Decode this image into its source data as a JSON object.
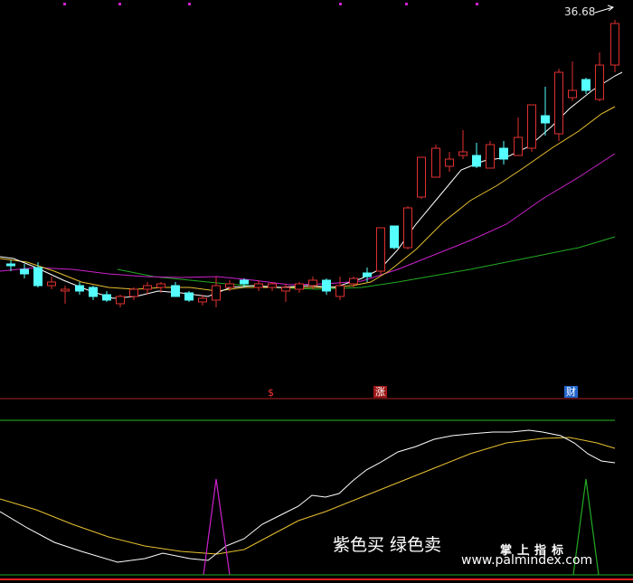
{
  "top_panel": {
    "price_label": "36.68",
    "signal_marks": [
      {
        "text": "$",
        "kind": "s"
      },
      {
        "text": "涨",
        "kind": "zhang"
      },
      {
        "text": "财",
        "kind": "cai"
      }
    ]
  },
  "bottom_panel": {
    "caption": "紫色买 绿色卖"
  },
  "watermark": {
    "line1": "掌上指标",
    "line2": "www.palmindex.com"
  },
  "colors": {
    "background": "#000000",
    "candle_up": "#e03030",
    "candle_down": "#55ffff",
    "ma_fast": "#ffffff",
    "ma_mid": "#e8c030",
    "ma_slow": "#cc22cc",
    "ma_long": "#22aa22",
    "separator": "#aa2222",
    "buy_signal": "#cc22cc",
    "sell_signal": "#22aa22"
  }
}
